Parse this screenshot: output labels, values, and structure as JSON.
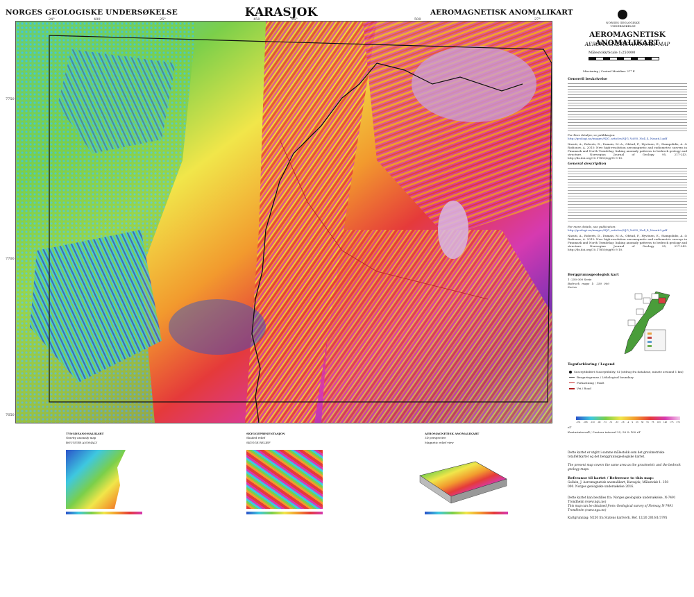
{
  "header": {
    "publisher": "NORGES GEOLOGISKE UNDERSØKELSE",
    "sheet_name": "KARASJOK",
    "map_type": "AEROMAGNETISK ANOMALIKART"
  },
  "sidebar": {
    "logo_text": "NORGES GEOLOGISKE UNDERSØKELSE",
    "title": "AEROMAGNETISK ANOMALIKART",
    "subtitle": "AEROMAGNETIC ANOMALY MAP",
    "scale": "Målestokk/Scale 1:250000",
    "magnetic_declination": "Misvisning / Central Meridian: 27° E",
    "general_heading_no": "Generell beskrivelse",
    "general_heading_en": "General description",
    "more_details_no": "For flere detaljer, se publikasjon:",
    "more_details_en": "For more details, see publication:",
    "link": "http://geologi.no/images/NJG_articles/NJG_Vol95_No4_4_Nasuti3.pdf",
    "reference": "Nasuti, A., Roberts, D., Dumais, M.-A., Ofstad, F., Hyvönen, E., Stampolidis, A. & Rodionov, A. 2015: New high-resolution aeromagnetic and radiometric surveys in Finnmark and North Trøndelag: linking anomaly patterns to bedrock geology and structure. Norwegian Journal of Geology 95, 217-243. http://dx.doi.org/10.17850/njg95-3-10.",
    "bedrock_heading": "Berggrunnsgeologisk kart",
    "bedrock_sub_no": "1: 250 000 Serie",
    "bedrock_sub_en": "Bedrock maps 1: 250 000 Series",
    "legend_heading": "Tegnforklaring / Legend",
    "legend_items": [
      "Susceptibilitet Susceptibility, SI (utdrag fra database, minste avstand 1 km)",
      "Bergartsgrense / Lithological boundary",
      "Forkastning / Fault",
      "Vei / Road"
    ],
    "colorbar_ticks": [
      "-274",
      "-186",
      "-132",
      "-98",
      "-72",
      "-51",
      "-33",
      "-18",
      "-4",
      "9",
      "23",
      "38",
      "55",
      "76",
      "103",
      "146",
      "175",
      "272"
    ],
    "colorbar_unit": "nT",
    "contour_note": "Konturintervall / Contour interval 25, 50 & 100 nT",
    "footer_note_no": "Dette kartet er utgitt i samme målestokk som det gravimetriske totalfeltkartet og det berggrunnsgeologiske kartet.",
    "footer_note_en": "The present map covers the same area as the gravimetric and the bedrock geology maps.",
    "citation_heading": "Referanse til kartet / Reference to this map:",
    "citation": "Gellein, J. Aeromagnetisk anomalikart, Karasjok, Målestokk 1: 250 000. Norges geologiske undersøkelse 2016.",
    "order_note": "Dette kartet kan bestilles fra: Norges geologiske undersøkelse, N-7491 Trondheim (www.ngu.no)",
    "order_note_en": "This map can be obtained from: Geological survey of Norway, N-7491 Trondheim (www.ngu.no)",
    "colophon": "Kartgrunnlag: N250 fra Statens kartverk. Ref. 12/20 2016/1/3795"
  },
  "insets": [
    {
      "title": "TYNGDEANOMALIKART",
      "sub": "Gravity anomaly map",
      "sub2": "BOUGUER ANOMALY"
    },
    {
      "title": "SKYGGEPRESENTASJON",
      "sub": "Shaded relief",
      "sub2": "SKYGGE RELIEF"
    },
    {
      "title": "AEROMAGNETISK ANOMALIKART",
      "sub": "3D perspective",
      "sub2": "Magnetic relief view"
    }
  ],
  "coordinates": {
    "top": [
      "24°",
      "400",
      "25°",
      "450",
      "26°",
      "500",
      "27°"
    ],
    "left": [
      "7750",
      "7700",
      "7650"
    ]
  },
  "colors": {
    "magenta": "#d63ab0",
    "red": "#e53a3a",
    "orange": "#f29a2e",
    "yellow": "#f1e64a",
    "green": "#7bcf4a",
    "cyan": "#3ec8e0",
    "blue": "#2b53c9",
    "purple": "#6a2fb5"
  }
}
